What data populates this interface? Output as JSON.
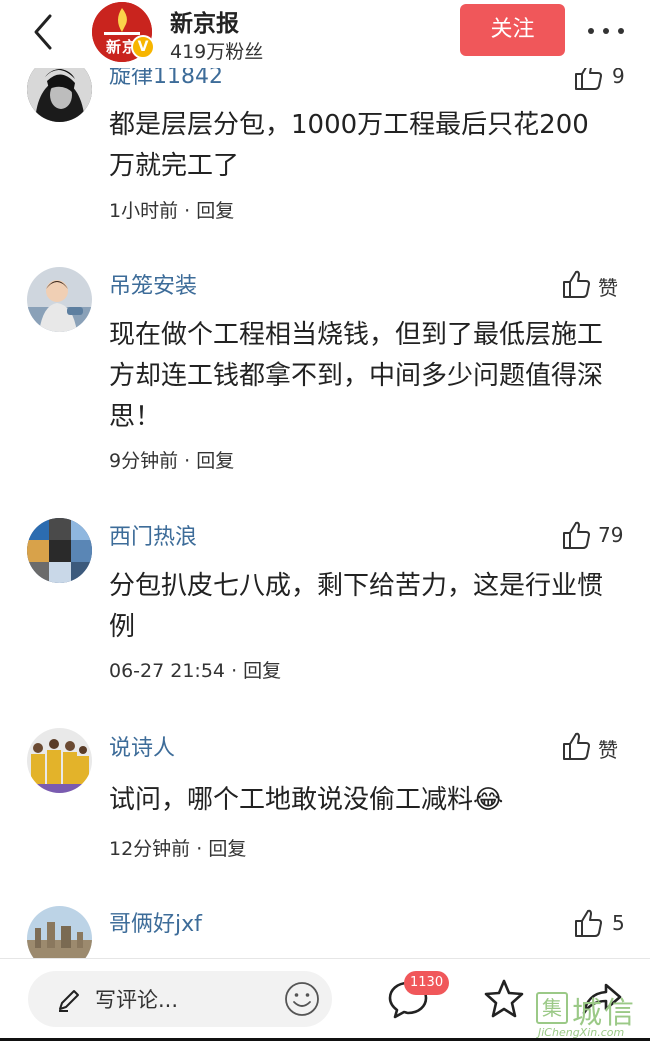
{
  "header": {
    "account_name": "新京报",
    "fans": "419万粉丝",
    "follow_label": "关注",
    "avatar_text": "新京",
    "verified_mark": "V"
  },
  "comments": [
    {
      "user": "旋律11842",
      "likes": "9",
      "text": "都是层层分包，1000万工程最后只花200万就完工了",
      "time": "1小时前",
      "reply_label": "回复"
    },
    {
      "user": "吊笼安装",
      "likes": "赞",
      "text": "现在做个工程相当烧钱，但到了最低层施工方却连工钱都拿不到，中间多少问题值得深思！",
      "time": "9分钟前",
      "reply_label": "回复"
    },
    {
      "user": "西门热浪",
      "likes": "79",
      "text": "分包扒皮七八成，剩下给苦力，这是行业惯例",
      "time": "06-27 21:54",
      "reply_label": "回复"
    },
    {
      "user": "说诗人",
      "likes": "赞",
      "text": "试问，哪个工地敢说没偷工减料",
      "emoji": "😂",
      "time": "12分钟前",
      "reply_label": "回复"
    },
    {
      "user": "哥俩好jxf",
      "likes": "5"
    }
  ],
  "bottom_bar": {
    "input_placeholder": "写评论...",
    "comment_count": "1130"
  },
  "watermark": {
    "text": "城信",
    "logo_char": "集",
    "sub": "JiChengXin.com"
  },
  "colors": {
    "accent": "#f0575a",
    "username": "#3d6c99",
    "brand_red": "#c9241e"
  }
}
